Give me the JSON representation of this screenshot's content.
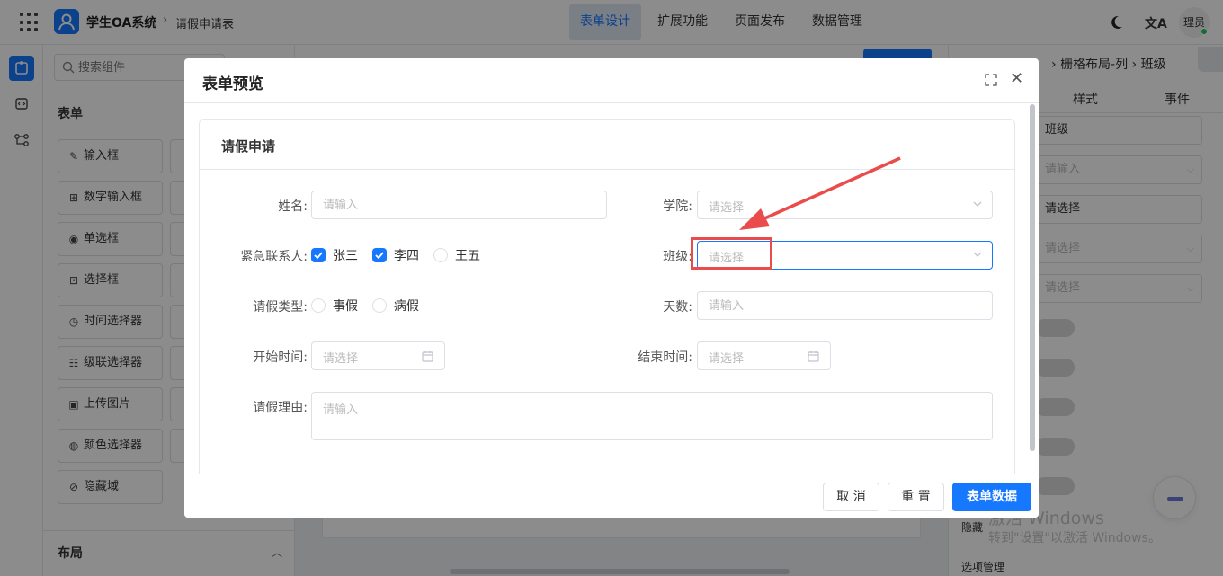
{
  "topbar": {
    "app_name": "学生OA系统",
    "breadcrumb_sep": "›",
    "breadcrumb": "请假申请表",
    "tabs": [
      "表单设计",
      "扩展功能",
      "页面发布",
      "数据管理"
    ],
    "translate_glyph": "文A",
    "user": "理员"
  },
  "component_panel": {
    "search_placeholder": "搜索组件",
    "section_form": "表单",
    "components": [
      "输入框",
      "数字输入框",
      "单选框",
      "选择框",
      "时间选择器",
      "级联选择器",
      "上传图片",
      "颜色选择器",
      "隐藏域"
    ],
    "component_icons": [
      "edit-icon",
      "number-icon",
      "radio-icon",
      "select-icon",
      "clock-icon",
      "cascade-icon",
      "image-icon",
      "palette-icon",
      "eye-off-icon"
    ],
    "section_layout": "布局"
  },
  "right_panel": {
    "breadcrumb": "› 栅格布局-列 › 班级",
    "tabs": [
      "样式",
      "事件"
    ],
    "fields": [
      {
        "value": "班级",
        "placeholder": false,
        "select": false
      },
      {
        "value": "请输入",
        "placeholder": true,
        "select": true
      },
      {
        "value": "请选择",
        "placeholder": false,
        "select": false
      },
      {
        "value": "请选择",
        "placeholder": true,
        "select": true
      },
      {
        "value": "请选择",
        "placeholder": true,
        "select": true
      }
    ],
    "label_hidden": "隐藏",
    "label_options": "选项管理"
  },
  "watermark": {
    "line1": "激活 Windows",
    "line2": "转到\"设置\"以激活 Windows。"
  },
  "modal": {
    "title": "表单预览",
    "card_title": "请假申请",
    "fields": {
      "name": {
        "label": "姓名:",
        "placeholder": "请输入"
      },
      "college": {
        "label": "学院:",
        "placeholder": "请选择"
      },
      "contact": {
        "label": "紧急联系人:",
        "options": [
          {
            "label": "张三",
            "checked": true
          },
          {
            "label": "李四",
            "checked": true
          },
          {
            "label": "王五",
            "checked": false
          }
        ]
      },
      "class": {
        "label": "班级:",
        "placeholder": "请选择"
      },
      "leave_type": {
        "label": "请假类型:",
        "options": [
          "事假",
          "病假"
        ]
      },
      "days": {
        "label": "天数:",
        "placeholder": "请输入"
      },
      "start_time": {
        "label": "开始时间:",
        "placeholder": "请选择"
      },
      "end_time": {
        "label": "结束时间:",
        "placeholder": "请选择"
      },
      "reason": {
        "label": "请假理由:",
        "placeholder": "请输入"
      }
    },
    "buttons": {
      "cancel": "取 消",
      "reset": "重 置",
      "submit": "表单数据"
    }
  },
  "colors": {
    "primary": "#1677ff",
    "annotation": "#ea4b4b",
    "overlay": "rgba(0,0,0,0.45)"
  }
}
